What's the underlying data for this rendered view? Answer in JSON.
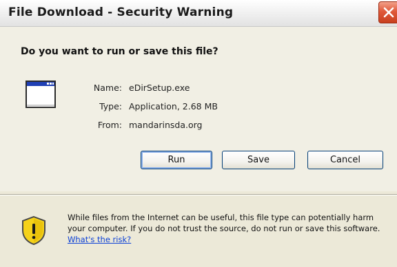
{
  "window": {
    "title": "File Download - Security Warning"
  },
  "dialog": {
    "question": "Do you want to run or save this file?",
    "file": {
      "name_label": "Name:",
      "name_value": "eDirSetup.exe",
      "type_label": "Type:",
      "type_value": "Application, 2.68 MB",
      "from_label": "From:",
      "from_value": "mandarinsda.org"
    },
    "buttons": {
      "run": "Run",
      "save": "Save",
      "cancel": "Cancel"
    },
    "warning": {
      "text": "While files from the Internet can be useful, this file type can potentially harm your computer. If you do not trust the source, do not run or save this software.",
      "link": "What's the risk?"
    }
  },
  "icons": {
    "close": "close-icon",
    "application": "application-window-icon",
    "warning": "security-shield-warning-icon"
  },
  "colors": {
    "dialog_background": "#ece9d8",
    "close_button": "#e0593a",
    "button_border": "#003c74",
    "link": "#0a3fd6",
    "shield_yellow": "#f5d21a"
  }
}
